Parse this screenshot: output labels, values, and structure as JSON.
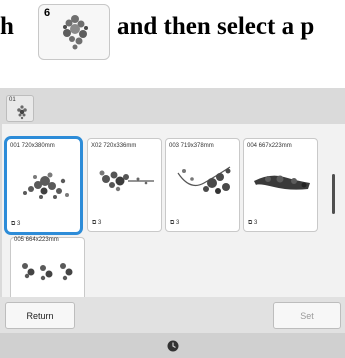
{
  "instruction": {
    "lead_text": "h",
    "category_number": "6",
    "rest_text": "and then select a p"
  },
  "category_tab": {
    "number": "01",
    "icon": "floral-embroidery-icon"
  },
  "designs": [
    {
      "label": "001 720x380mm",
      "count": "3",
      "selected": true,
      "art": "floral-spray-thumbnail"
    },
    {
      "label": "X02 720x336mm",
      "count": "3",
      "selected": false,
      "art": "floral-garland-thumbnail"
    },
    {
      "label": "003 719x378mm",
      "count": "3",
      "selected": false,
      "art": "vine-border-thumbnail"
    },
    {
      "label": "004 667x223mm",
      "count": "3",
      "selected": false,
      "art": "dark-floral-band-thumbnail"
    },
    {
      "label": "005 664x223mm",
      "count": "",
      "selected": false,
      "art": "flower-row-thumbnail"
    }
  ],
  "buttons": {
    "return_label": "Return",
    "set_label": "Set"
  },
  "status": {
    "icon": "clock-icon"
  },
  "colors": {
    "selection": "#2d8cd8",
    "screen_bg": "#dadada",
    "grid_bg": "#f2f2f2"
  }
}
